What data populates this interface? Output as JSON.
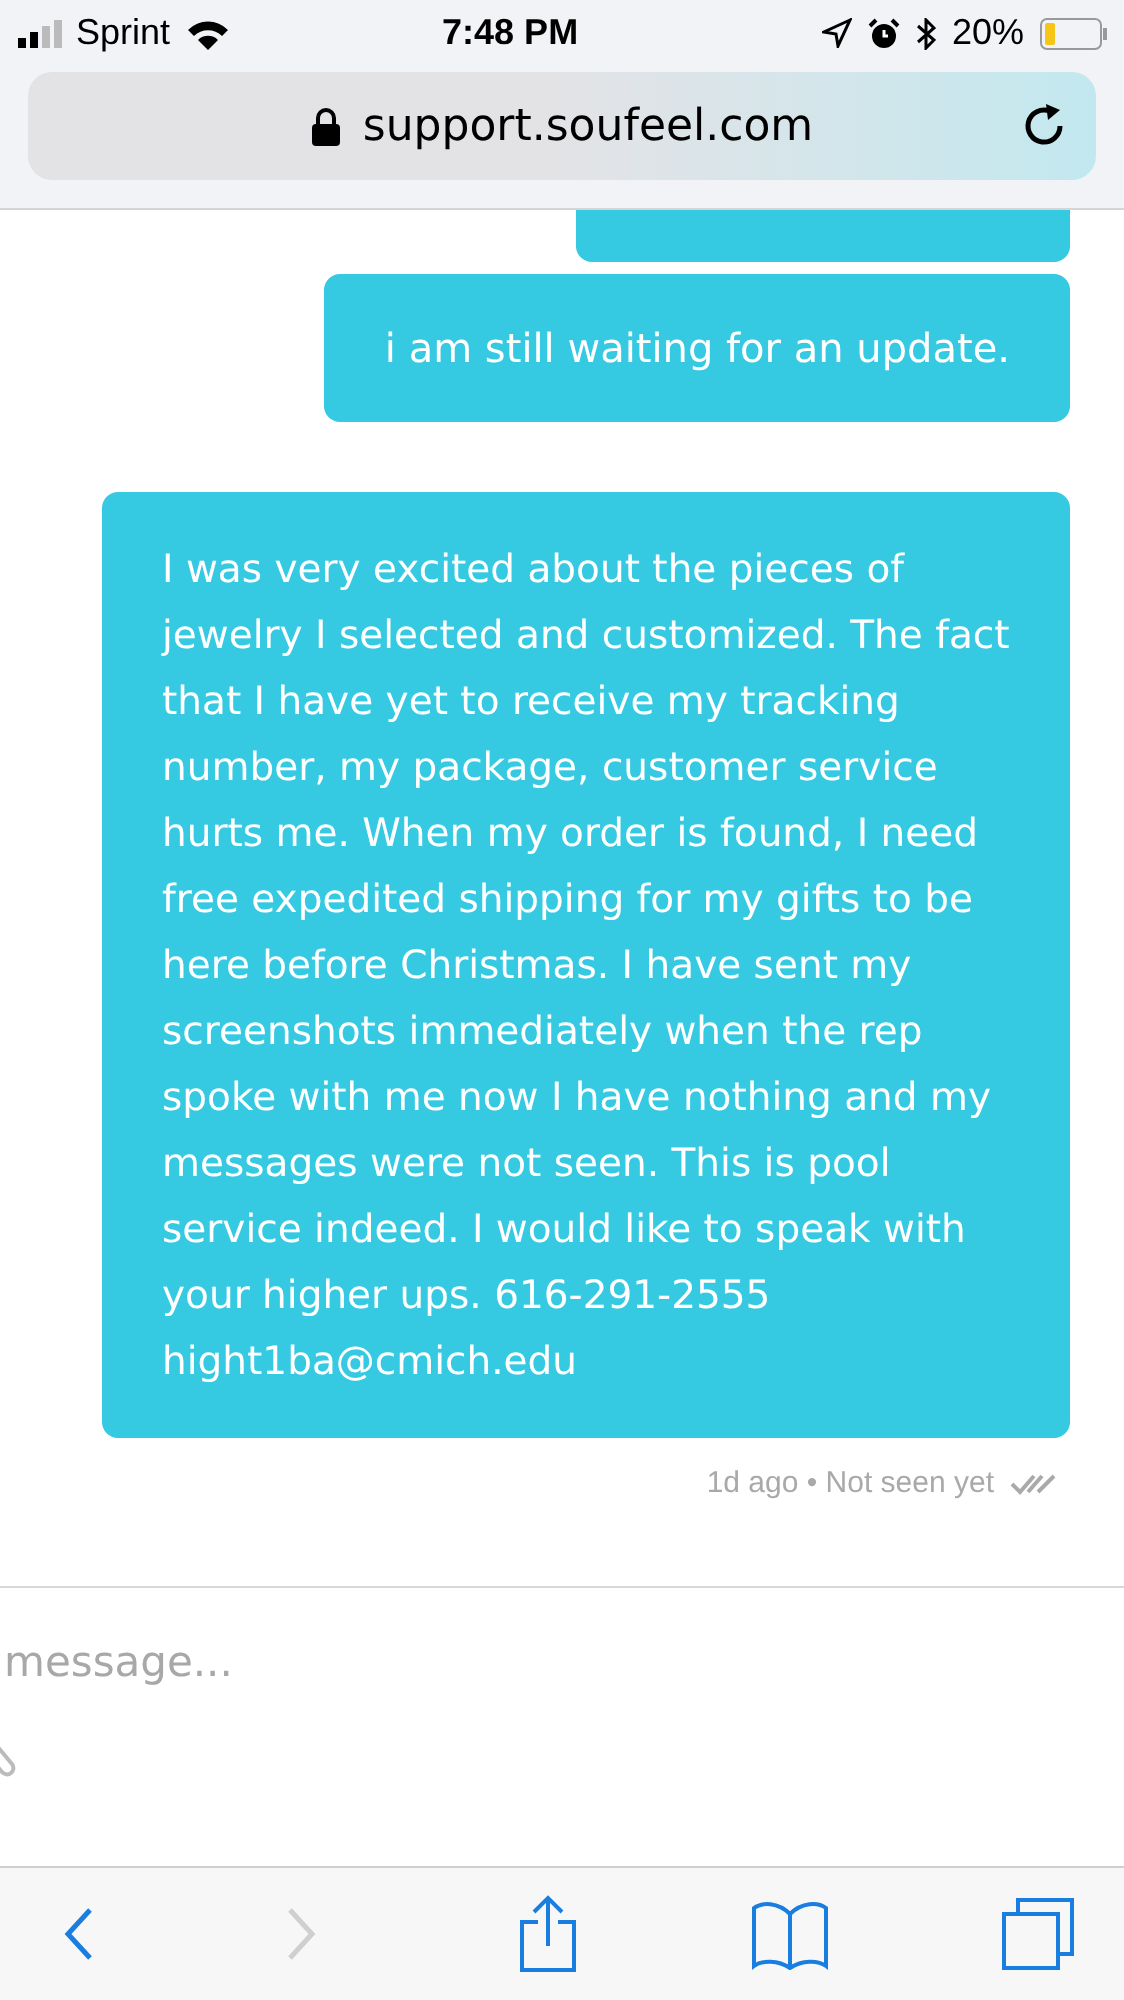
{
  "status_bar": {
    "carrier": "Sprint",
    "time": "7:48 PM",
    "battery": "20%"
  },
  "address_bar": {
    "url": "support.soufeel.com"
  },
  "messages": [
    {
      "kind": "cut"
    },
    {
      "text": "i am still waiting for an update.",
      "kind": "full"
    },
    {
      "text": "I was very excited about the pieces of jewelry I selected and customized. The fact that I have yet to receive my tracking number, my package, customer service hurts me. When my order is found, I need free expedited shipping for my gifts to be here before Christmas. I have sent my screenshots immediately when the rep spoke with me now I have nothing and my messages were not seen. This is pool service indeed. I would like to speak with your higher ups. 616-291-2555 hight1ba@cmich.edu",
      "kind": "full"
    }
  ],
  "message_meta": "1d ago • Not seen yet",
  "composer": {
    "placeholder": "message..."
  },
  "toolbar": {
    "back_disabled": false,
    "forward_disabled": true
  }
}
